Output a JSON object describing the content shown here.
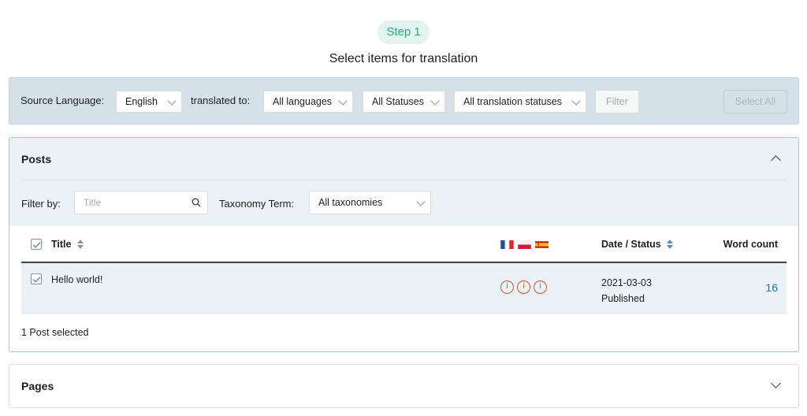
{
  "step": {
    "badge": "Step 1",
    "title": "Select items for translation"
  },
  "filter_bar": {
    "source_label": "Source Language:",
    "source_value": "English",
    "translated_label": "translated to:",
    "languages_value": "All languages",
    "statuses_value": "All Statuses",
    "translation_statuses_value": "All translation statuses",
    "filter_button": "Filter",
    "select_all_button": "Select All"
  },
  "posts": {
    "title": "Posts",
    "filter_by_label": "Filter by:",
    "title_placeholder": "Title",
    "taxonomy_label": "Taxonomy Term:",
    "taxonomy_value": "All taxonomies",
    "columns": {
      "title": "Title",
      "date_status": "Date / Status",
      "word_count": "Word count"
    },
    "rows": [
      {
        "title": "Hello world!",
        "date": "2021-03-03",
        "status": "Published",
        "word_count": "16",
        "statuses": [
          "info",
          "info",
          "info"
        ]
      }
    ],
    "selected_text": "1 Post selected"
  },
  "pages": {
    "title": "Pages"
  },
  "flags": [
    "fr",
    "pl",
    "es"
  ],
  "colors": {
    "accent": "#2271b1",
    "step_badge_bg": "#e3f3ee",
    "step_badge_text": "#2aa98a",
    "filter_bar_bg": "#d5e1e9",
    "panel_head_bg": "#eaf2f6",
    "status_icon": "#d9532c"
  }
}
